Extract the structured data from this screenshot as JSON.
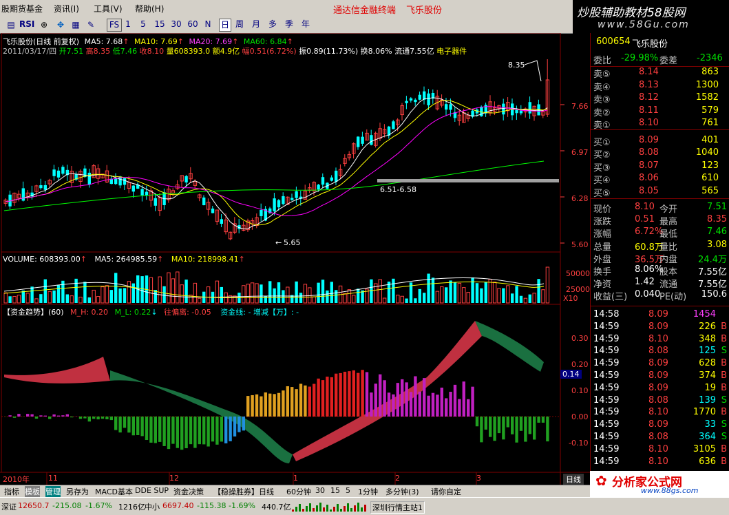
{
  "menu": {
    "items": [
      "股期货基金",
      "资讯(I)",
      "工具(V)",
      "帮助(H)"
    ],
    "center_title_prefix": "通达信金融终端",
    "center_title_stock": "飞乐股份",
    "watermark": "炒股辅助教材58股网",
    "watermark_url": "www.58Gu.com"
  },
  "toolbar": {
    "rsi_label": "RSI",
    "fs_label": "FS",
    "periods": [
      "1",
      "5",
      "15",
      "30",
      "60",
      "N",
      "日",
      "周",
      "月",
      "多",
      "季",
      "年"
    ],
    "selected_period": "日"
  },
  "main_chart": {
    "title": "飞乐股份(日线 前复权)",
    "ma_labels": [
      "MA5: 7.68",
      "MA10: 7.69",
      "MA20: 7.69",
      "MA60: 6.84"
    ],
    "info_date": "2011/03/17/四",
    "info_items": [
      "开7.51",
      "高8.35",
      "低7.46",
      "收8.10",
      "量608393.0",
      "额4.9亿",
      "幅0.51(6.72%)",
      "振0.89(11.73%)",
      "换8.06%",
      "流通7.55亿",
      "电子器件"
    ],
    "annot_high": "8.35",
    "annot_low": "5.65",
    "annot_mid": "6.51-6.58",
    "price_ticks": [
      "7.66",
      "6.97",
      "6.28",
      "5.60"
    ]
  },
  "volume_chart": {
    "title": "VOLUME: 608393.00",
    "ma5": "MA5: 264985.59",
    "ma10": "MA10: 218998.41",
    "ticks": [
      "50000",
      "25000"
    ],
    "unit": "X10"
  },
  "indicator_chart": {
    "title": "【资金趋势】(60)",
    "m_h": "M_H: 0.20",
    "m_l": "M_L: 0.22",
    "wangfu": "往偏离: -0.05",
    "zijinxian": "资金线: - 增减【万】: -",
    "ticks": [
      "0.30",
      "0.20",
      "0.10",
      "0.00",
      "-0.10"
    ],
    "current_value": "0.14"
  },
  "time_axis": {
    "labels": [
      "2010年",
      "11",
      "12",
      "1",
      "2",
      "3"
    ],
    "period_label": "日线"
  },
  "right_panel": {
    "code": "600654",
    "name": "飞乐股份",
    "weibi_label": "委比",
    "weibi_value": "-29.98%",
    "weicha_label": "委差",
    "weicha_value": "-2346",
    "sells": [
      {
        "label": "卖⑤",
        "price": "8.14",
        "vol": "863"
      },
      {
        "label": "卖④",
        "price": "8.13",
        "vol": "1300"
      },
      {
        "label": "卖③",
        "price": "8.12",
        "vol": "1582"
      },
      {
        "label": "卖②",
        "price": "8.11",
        "vol": "579"
      },
      {
        "label": "卖①",
        "price": "8.10",
        "vol": "761"
      }
    ],
    "buys": [
      {
        "label": "买①",
        "price": "8.09",
        "vol": "401"
      },
      {
        "label": "买②",
        "price": "8.08",
        "vol": "1040"
      },
      {
        "label": "买③",
        "price": "8.07",
        "vol": "123"
      },
      {
        "label": "买④",
        "price": "8.06",
        "vol": "610"
      },
      {
        "label": "买⑤",
        "price": "8.05",
        "vol": "565"
      }
    ],
    "stats": [
      {
        "l1": "现价",
        "v1": "8.10",
        "l2": "今开",
        "v2": "7.51"
      },
      {
        "l1": "涨跌",
        "v1": "0.51",
        "l2": "最高",
        "v2": "8.35"
      },
      {
        "l1": "涨幅",
        "v1": "6.72%",
        "l2": "最低",
        "v2": "7.46"
      },
      {
        "l1": "总量",
        "v1": "60.8万",
        "l2": "量比",
        "v2": "3.08"
      },
      {
        "l1": "外盘",
        "v1": "36.5万",
        "l2": "内盘",
        "v2": "24.4万"
      },
      {
        "l1": "换手",
        "v1": "8.06%",
        "l2": "股本",
        "v2": "7.55亿"
      },
      {
        "l1": "净资",
        "v1": "1.42",
        "l2": "流通",
        "v2": "7.55亿"
      },
      {
        "l1": "收益(三)",
        "v1": "0.040",
        "l2": "PE(动)",
        "v2": "150.6"
      }
    ],
    "ticks": [
      {
        "time": "14:58",
        "price": "8.09",
        "vol": "1454",
        "side": ""
      },
      {
        "time": "14:59",
        "price": "8.09",
        "vol": "226",
        "side": "B"
      },
      {
        "time": "14:59",
        "price": "8.10",
        "vol": "348",
        "side": "B"
      },
      {
        "time": "14:59",
        "price": "8.08",
        "vol": "125",
        "side": "S"
      },
      {
        "time": "14:59",
        "price": "8.09",
        "vol": "628",
        "side": "B"
      },
      {
        "time": "14:59",
        "price": "8.09",
        "vol": "374",
        "side": "B"
      },
      {
        "time": "14:59",
        "price": "8.09",
        "vol": "19",
        "side": "B"
      },
      {
        "time": "14:59",
        "price": "8.08",
        "vol": "139",
        "side": "S"
      },
      {
        "time": "14:59",
        "price": "8.10",
        "vol": "1770",
        "side": "B"
      },
      {
        "time": "14:59",
        "price": "8.09",
        "vol": "33",
        "side": "S"
      },
      {
        "time": "14:59",
        "price": "8.08",
        "vol": "364",
        "side": "S"
      },
      {
        "time": "14:59",
        "price": "8.10",
        "vol": "3105",
        "side": "B"
      },
      {
        "time": "14:59",
        "price": "8.10",
        "vol": "636",
        "side": "B"
      }
    ],
    "logo_text": "分析家公式网",
    "logo_url": "www.88gs.com"
  },
  "bottom_tabs": [
    "指标",
    "模板",
    "管理",
    "另存为",
    "MACD基本",
    "DDE SUP",
    "资金决策",
    "【稳操胜券】日线",
    "60分钟",
    "30",
    "15",
    "5",
    "1分钟",
    "多分钟(3)",
    "请你自定"
  ],
  "status_bar": {
    "sz_label": "深证",
    "sz_value": "12650.7",
    "sz_change": "-215.08",
    "sz_pct": "-1.67%",
    "sz_amount": "1216亿",
    "zx_label": "中小",
    "zx_value": "6697.40",
    "zx_change": "-115.38",
    "zx_pct": "-1.69%",
    "zx_amount": "440.7亿",
    "station": "深圳行情主站1"
  },
  "colors": {
    "up": "#ff4040",
    "down": "#00ffff",
    "ma5": "#ffffff",
    "ma10": "#ffff00",
    "ma20": "#ff00ff",
    "ma60": "#00ff00"
  }
}
